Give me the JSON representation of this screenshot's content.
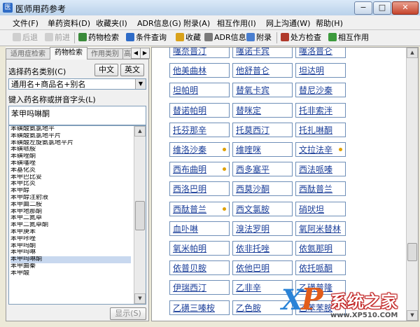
{
  "window": {
    "title": "医师用药参考",
    "controls": {
      "minimize": "−",
      "maximize": "□",
      "close": "✕"
    }
  },
  "menu": [
    "文件(F)",
    "单药资料(D)",
    "收藏夹(I)",
    "ADR信息(G)",
    "附录(A)",
    "相互作用(I)",
    "网上沟通(W)",
    "帮助(H)"
  ],
  "toolbar": {
    "back": "后退",
    "forward": "前进",
    "drug_search": "药物检索",
    "condition_search": "条件查询",
    "favorites": "收藏",
    "adr_info": "ADR信息",
    "appendix": "附录",
    "prescription_check": "处方检查",
    "interaction": "相互作用"
  },
  "left": {
    "tabs": [
      "适用症检索",
      "药物检索",
      "作用类别",
      "高"
    ],
    "active_tab": 1,
    "category_label": "选择药名类别(C)",
    "lang_cn": "中文",
    "lang_en": "英文",
    "category_value": "通用名+商品名+别名",
    "input_label": "键入药名称或拼音字头(L)",
    "search_value": "苯甲吗啉酮",
    "list_items": [
      "苯磺酸氨氯地平",
      "苯磺酸氨氯地平片",
      "苯磺酸左旋氨氯地平片",
      "苯磺哌胺",
      "苯磺唑酮",
      "苯磺噻唑",
      "苯基化炎",
      "苯甲巴比妥",
      "苯甲比炎",
      "苯甲醇",
      "苯甲醇注射液",
      "苯甲曲二胺",
      "苯甲地那酮",
      "苯甲二氮卓",
      "苯甲二氮卓酮",
      "苯甲庚苯",
      "苯甲咔唑",
      "苯甲吗酮",
      "苯甲吗啉",
      "苯甲吗啉酮",
      "苯甲曲秦",
      "苯甲酸"
    ],
    "selected_index": 19,
    "apply_button": "显示(S)"
  },
  "drugs": [
    [
      "噻奈普汀",
      "噻诺卡宾",
      "噻洛普仑"
    ],
    [
      "他美曲林",
      "他舒普仑",
      "坦达明"
    ],
    [
      "坦帕明",
      "替氧卡宾",
      "替尼沙秦"
    ],
    [
      "替诺帕明",
      "替咪定",
      "托非索泮"
    ],
    [
      "托芬那辛",
      "托莫西汀",
      "托扎啉酮"
    ],
    [
      "维洛沙秦",
      "维喹咪",
      "文拉法辛"
    ],
    [
      "西布曲明",
      "西多塞平",
      "西法哌嗪"
    ],
    [
      "西洛巴明",
      "西莫沙酮",
      "西酞普兰"
    ],
    [
      "西酞普兰",
      "西文氯胺",
      "硝吠坦"
    ],
    [
      "血卟啉",
      "溴法罗明",
      "氧阿米替林"
    ],
    [
      "氧米帕明",
      "依非托唑",
      "依氨那明"
    ],
    [
      "依普贝胺",
      "依他巴明",
      "依托哌酮"
    ],
    [
      "伊瑞西汀",
      "乙非辛",
      "乙磺普隆"
    ],
    [
      "乙磺三嗪桉",
      "乙色胺",
      "乙苯苯胺"
    ]
  ],
  "starred": [
    [
      5,
      0
    ],
    [
      5,
      2
    ],
    [
      6,
      0
    ],
    [
      8,
      0
    ]
  ],
  "watermark": {
    "x": "X",
    "p": "P",
    "text": "系统之家",
    "url": "www.XP510.COM"
  },
  "colors": {
    "link": "#1b3f9a",
    "cell_border": "#6f8fb8",
    "star": "#e0a000"
  }
}
